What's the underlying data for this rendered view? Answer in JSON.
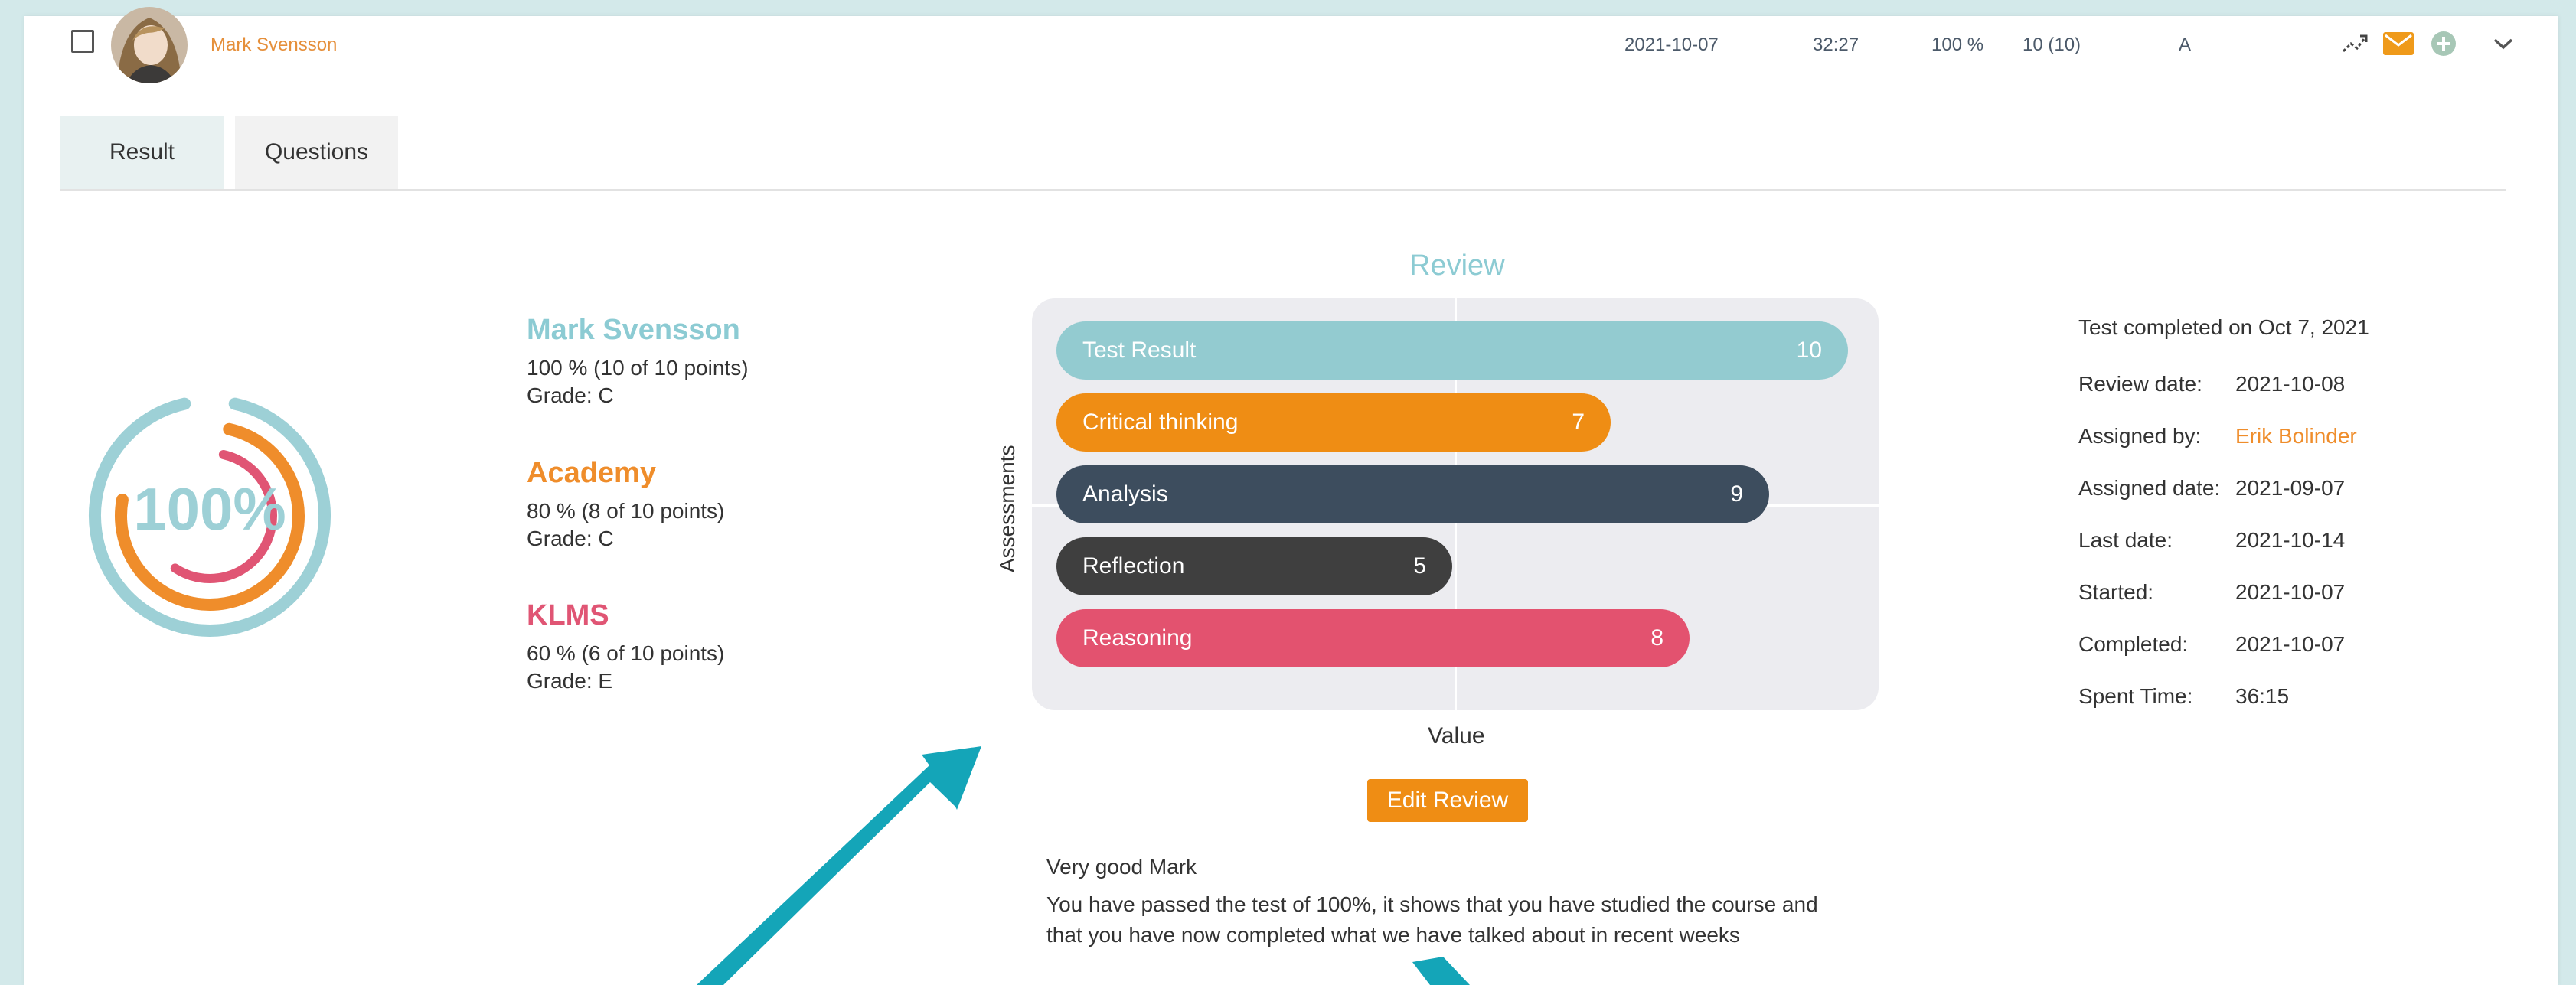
{
  "row": {
    "student_name": "Mark Svensson",
    "date": "2021-10-07",
    "duration": "32:27",
    "percent": "100 %",
    "points": "10 (10)",
    "grade": "A",
    "icons": [
      "trend-icon",
      "mail-icon",
      "add-icon",
      "chevron-down-icon"
    ]
  },
  "tabs": [
    {
      "label": "Result",
      "active": true
    },
    {
      "label": "Questions",
      "active": false
    }
  ],
  "score_ring": {
    "center_text": "100%",
    "rings": [
      {
        "name": "Mark Svensson",
        "fraction": 1.0,
        "color": "#9dd0d6"
      },
      {
        "name": "Academy",
        "fraction": 0.8,
        "color": "#ef8d2b"
      },
      {
        "name": "KLMS",
        "fraction": 0.6,
        "color": "#e05574"
      }
    ]
  },
  "groups": [
    {
      "name": "Mark Svensson",
      "line1": "100 %  (10 of 10 points)",
      "line2": "Grade: C",
      "color": "#8ccbd3"
    },
    {
      "name": "Academy",
      "line1": "80 %  (8 of 10 points)",
      "line2": "Grade: C",
      "color": "#ef8d2b"
    },
    {
      "name": "KLMS",
      "line1": "60 %  (6 of 10 points)",
      "line2": "Grade: E",
      "color": "#e05574"
    }
  ],
  "chart_data": {
    "type": "bar",
    "orientation": "horizontal",
    "title": "Review",
    "xlabel": "Value",
    "ylabel": "Assessments",
    "xlim": [
      0,
      10
    ],
    "grid": true,
    "categories": [
      "Test Result",
      "Critical thinking",
      "Analysis",
      "Reflection",
      "Reasoning"
    ],
    "values": [
      10,
      7,
      9,
      5,
      8
    ],
    "colors": [
      "#93cbd0",
      "#ef8d14",
      "#3d4d5e",
      "#3f3f3f",
      "#e3526f"
    ]
  },
  "review": {
    "edit_label": "Edit Review",
    "heading": "Very good Mark",
    "line1": "You have passed the test of 100%, it shows that you have studied the course and",
    "line2": "that you have now completed what we have talked about in recent weeks"
  },
  "details": {
    "completed_text": "Test completed on Oct 7, 2021",
    "items": [
      {
        "label": "Review date:",
        "value": "2021-10-08"
      },
      {
        "label": "Assigned by:",
        "value": "Erik Bolinder",
        "link": true
      },
      {
        "label": "Assigned date:",
        "value": "2021-09-07"
      },
      {
        "label": "Last date:",
        "value": "2021-10-14"
      },
      {
        "label": "Started:",
        "value": "2021-10-07"
      },
      {
        "label": "Completed:",
        "value": "2021-10-07"
      },
      {
        "label": "Spent Time:",
        "value": "36:15"
      }
    ]
  },
  "accent_colors": {
    "arrow": "#14a5b8",
    "link": "#ef8d2b"
  }
}
